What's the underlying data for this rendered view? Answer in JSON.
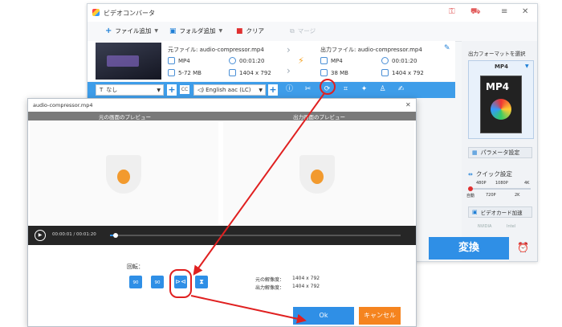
{
  "app": {
    "title": "ビデオコンバータ",
    "toolbar": {
      "add_file": "ファイル追加",
      "add_folder": "フォルダ追加",
      "clear": "クリア",
      "merge": "マージ"
    },
    "source": {
      "label": "元ファイル: audio-compressor.mp4",
      "format": "MP4",
      "duration": "00:01:20",
      "size": "5-72 MB",
      "resolution": "1404 x 792"
    },
    "output": {
      "label": "出力ファイル: audio-compressor.mp4",
      "format": "MP4",
      "duration": "00:01:20",
      "size": "38 MB",
      "resolution": "1404 x 792"
    },
    "editbar": {
      "subtitle_value": "なし",
      "audio_value": "English aac (LC)"
    },
    "right_panel": {
      "select_format": "出力フォーマットを選択",
      "format": "MP4",
      "param_settings": "パラメータ設定",
      "quick_settings": "クイック設定",
      "res_top": [
        "480P",
        "1080P",
        "4K"
      ],
      "res_bottom": [
        "自動",
        "720P",
        "2K"
      ],
      "gpu_accel": "ビデオカード加速",
      "gpu_vendors": [
        "NVIDIA",
        "Intel"
      ]
    },
    "convert_label": "変換"
  },
  "dialog": {
    "title": "audio-compressor.mp4",
    "source_preview": "元の画面のプレビュー",
    "output_preview": "出力画面のプレビュー",
    "time": "00:00:01 / 00:01:20",
    "progress": 0.02,
    "rotate_label": "回転：",
    "rotate_buttons": [
      "90",
      "90"
    ],
    "orig_res_label": "元の解像度：",
    "orig_res_value": "1404 x 792",
    "out_res_label": "出力解像度：",
    "out_res_value": "1404 x 792",
    "ok": "Ok",
    "cancel": "キャンセル"
  },
  "colors": {
    "accent": "#2f8fe6",
    "cancel": "#f5841f",
    "highlight": "#e02020"
  }
}
